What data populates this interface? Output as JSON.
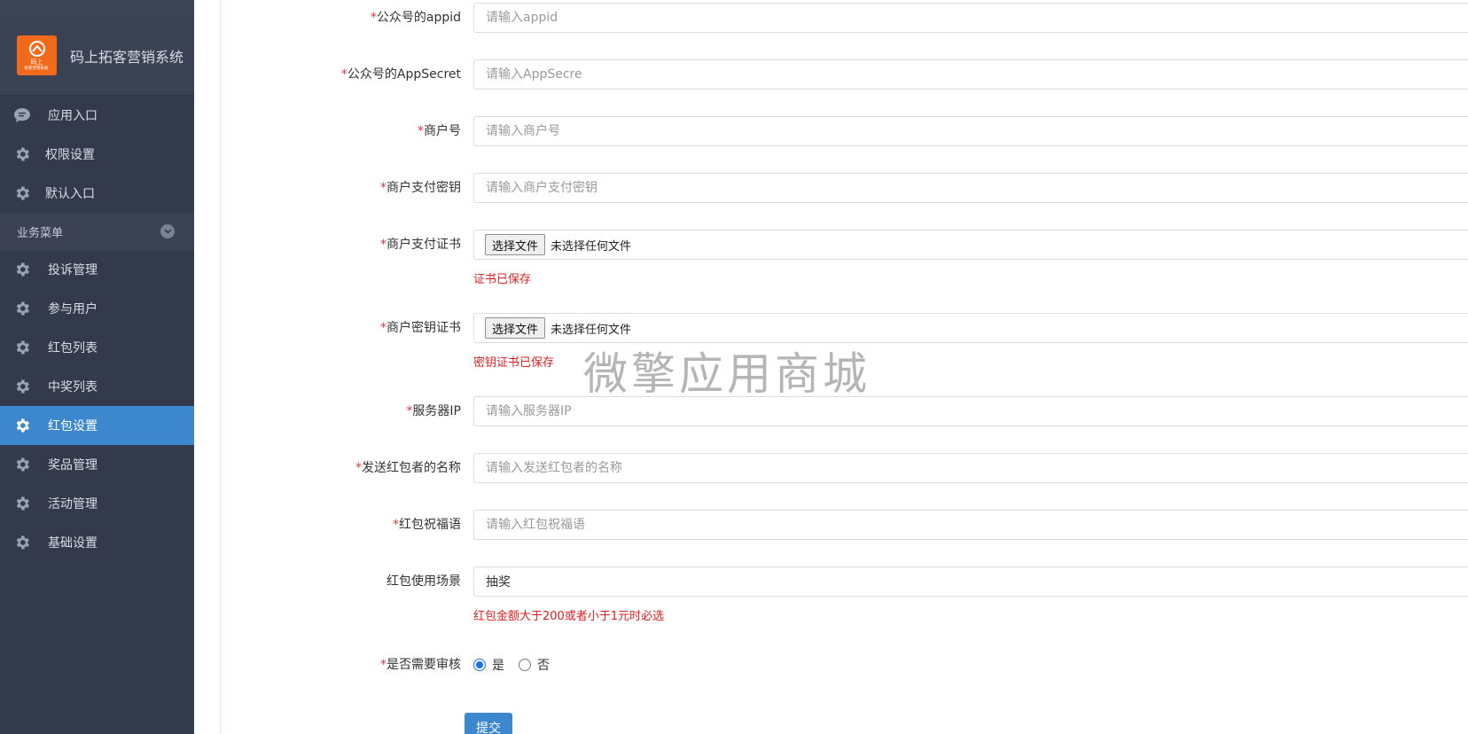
{
  "brand": {
    "title": "码上拓客营销系统",
    "logo_line1": "码上",
    "logo_line2": "拓客营销系统"
  },
  "sidebar": {
    "top_items": [
      {
        "label": "应用入口",
        "icon": "chat-icon"
      },
      {
        "label": "权限设置",
        "icon": "gear-icon"
      },
      {
        "label": "默认入口",
        "icon": "gear-icon"
      }
    ],
    "section_label": "业务菜单",
    "menu_items": [
      {
        "label": "投诉管理",
        "icon": "gear-icon"
      },
      {
        "label": "参与用户",
        "icon": "gear-icon"
      },
      {
        "label": "红包列表",
        "icon": "gear-icon"
      },
      {
        "label": "中奖列表",
        "icon": "gear-icon"
      },
      {
        "label": "红包设置",
        "icon": "gear-icon",
        "active": true
      },
      {
        "label": "奖品管理",
        "icon": "gear-icon"
      },
      {
        "label": "活动管理",
        "icon": "gear-icon"
      },
      {
        "label": "基础设置",
        "icon": "gear-icon"
      }
    ]
  },
  "form": {
    "required_mark": "*",
    "appid": {
      "label": "公众号的appid",
      "placeholder": "请输入appid",
      "value": ""
    },
    "appsecret": {
      "label": "公众号的AppSecret",
      "placeholder": "请输入AppSecre",
      "value": ""
    },
    "merchant_id": {
      "label": "商户号",
      "placeholder": "请输入商户号",
      "value": ""
    },
    "pay_key": {
      "label": "商户支付密钥",
      "placeholder": "请输入商户支付密钥",
      "value": ""
    },
    "pay_cert": {
      "label": "商户支付证书",
      "button": "选择文件",
      "file_status": "未选择任何文件",
      "hint": "证书已保存"
    },
    "key_cert": {
      "label": "商户密钥证书",
      "button": "选择文件",
      "file_status": "未选择任何文件",
      "hint": "密钥证书已保存"
    },
    "server_ip": {
      "label": "服务器IP",
      "placeholder": "请输入服务器IP",
      "value": ""
    },
    "sender_name": {
      "label": "发送红包者的名称",
      "placeholder": "请输入发送红包者的名称",
      "value": ""
    },
    "wishing": {
      "label": "红包祝福语",
      "placeholder": "请输入红包祝福语",
      "value": ""
    },
    "scene": {
      "label": "红包使用场景",
      "value": "抽奖",
      "hint": "红包金额大于200或者小于1元时必选"
    },
    "review": {
      "label": "是否需要审核",
      "yes": "是",
      "no": "否",
      "selected": "是"
    },
    "submit_label": "提交"
  },
  "watermark": "微擎应用商城",
  "colors": {
    "sidebar_bg": "#323a4c",
    "accent": "#3d87cf",
    "required": "#e4393c",
    "hint": "#e02020",
    "logo": "#f26a1b"
  }
}
